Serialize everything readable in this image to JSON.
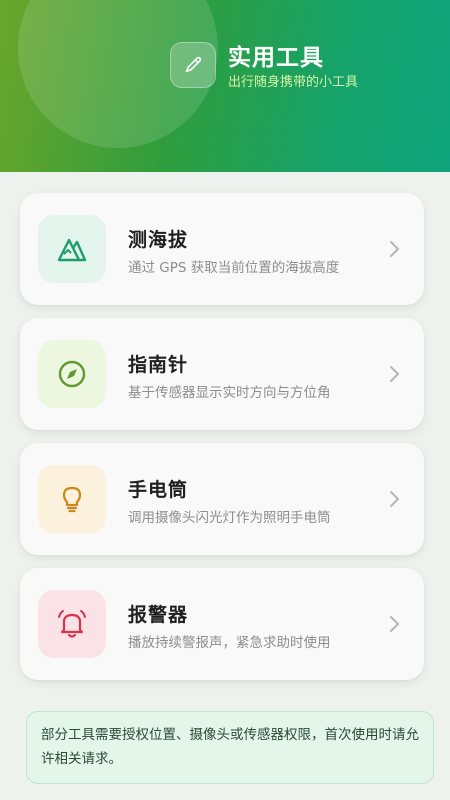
{
  "header": {
    "title": "实用工具",
    "subtitle": "出行随身携带的小工具",
    "icon": "pencil-icon"
  },
  "tools": [
    {
      "title": "测海拔",
      "description": "通过 GPS 获取当前位置的海拔高度",
      "icon": "mountain-icon",
      "color": "#1e9c6a",
      "bg": "#e3f4ec"
    },
    {
      "title": "指南针",
      "description": "基于传感器显示实时方向与方位角",
      "icon": "compass-icon",
      "color": "#5e9a2e",
      "bg": "#edf6df"
    },
    {
      "title": "手电筒",
      "description": "调用摄像头闪光灯作为照明手电筒",
      "icon": "lightbulb-icon",
      "color": "#c88a1c",
      "bg": "#fbf1dc"
    },
    {
      "title": "报警器",
      "description": "播放持续警报声，紧急求助时使用",
      "icon": "bell-alarm-icon",
      "color": "#d8344a",
      "bg": "#fbe2e6"
    }
  ],
  "notice": {
    "text": "部分工具需要授权位置、摄像头或传感器权限，首次使用时请允许相关请求。"
  }
}
